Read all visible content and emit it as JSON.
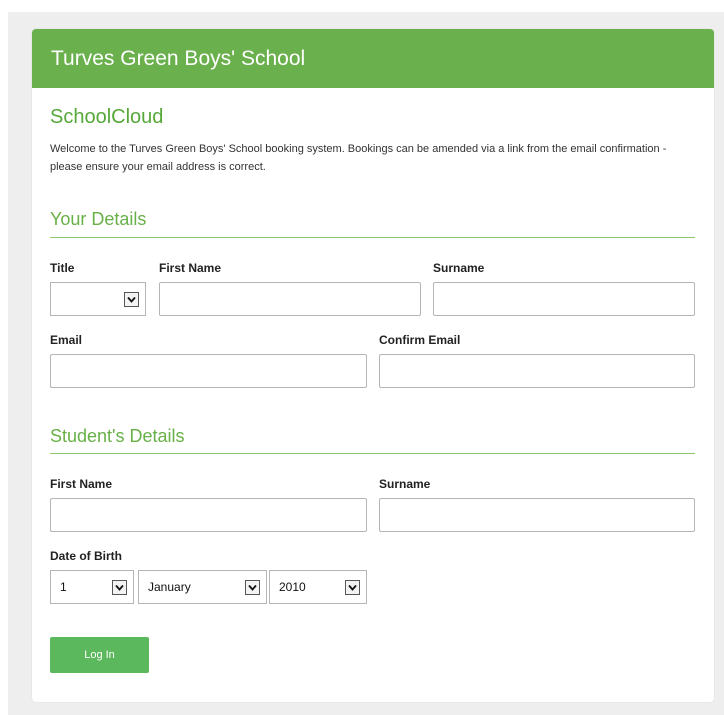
{
  "header": {
    "title": "Turves Green Boys' School"
  },
  "app": {
    "name": "SchoolCloud",
    "welcome": "Welcome to the Turves Green Boys' School booking system. Bookings can be amended via a link from the email confirmation - please ensure your email address is correct."
  },
  "your_details": {
    "heading": "Your Details",
    "title_label": "Title",
    "title_value": "",
    "first_name_label": "First Name",
    "first_name_value": "",
    "surname_label": "Surname",
    "surname_value": "",
    "email_label": "Email",
    "email_value": "",
    "confirm_email_label": "Confirm Email",
    "confirm_email_value": ""
  },
  "student_details": {
    "heading": "Student's Details",
    "first_name_label": "First Name",
    "first_name_value": "",
    "surname_label": "Surname",
    "surname_value": "",
    "dob_label": "Date of Birth",
    "dob_day": "1",
    "dob_month": "January",
    "dob_year": "2010"
  },
  "actions": {
    "login_label": "Log In"
  },
  "colors": {
    "header_green": "#6ab04c",
    "title_green": "#56a83a",
    "button_green": "#5cb85c"
  },
  "icons": {
    "select_arrow": "chevron-down-icon"
  }
}
